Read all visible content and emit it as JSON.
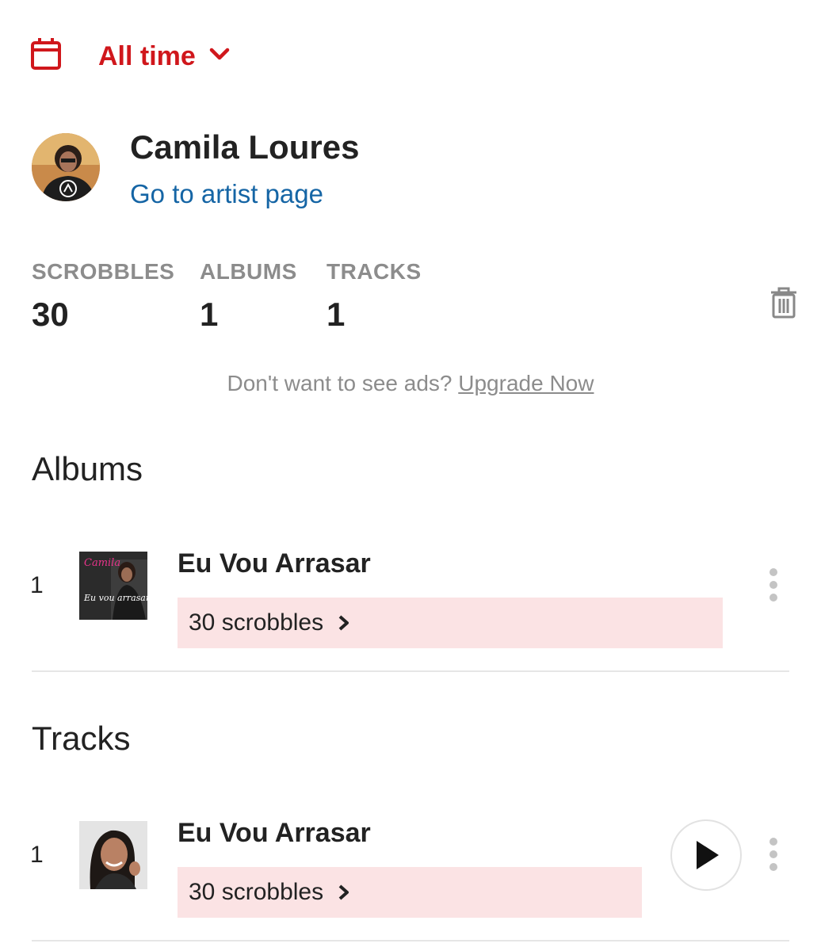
{
  "period": {
    "label": "All time",
    "icon": "calendar-icon"
  },
  "artist": {
    "name": "Camila Loures",
    "link_label": "Go to artist page"
  },
  "stats": [
    {
      "key": "SCROBBLES",
      "value": "30"
    },
    {
      "key": "ALBUMS",
      "value": "1"
    },
    {
      "key": "TRACKS",
      "value": "1"
    }
  ],
  "ads": {
    "text": "Don't want to see ads?",
    "link": "Upgrade Now"
  },
  "albums": {
    "title": "Albums",
    "items": [
      {
        "rank": "1",
        "title": "Eu Vou Arrasar",
        "scrobbles": "30 scrobbles",
        "cover_text_top": "Camila",
        "cover_text_bottom": "Eu vou arrasar"
      }
    ]
  },
  "tracks": {
    "title": "Tracks",
    "items": [
      {
        "rank": "1",
        "title": "Eu Vou Arrasar",
        "scrobbles": "30 scrobbles"
      }
    ]
  },
  "colors": {
    "accent": "#d0171c",
    "link": "#1565a5",
    "scrobble_bar": "#fbe3e4",
    "muted": "#8c8c8c"
  }
}
